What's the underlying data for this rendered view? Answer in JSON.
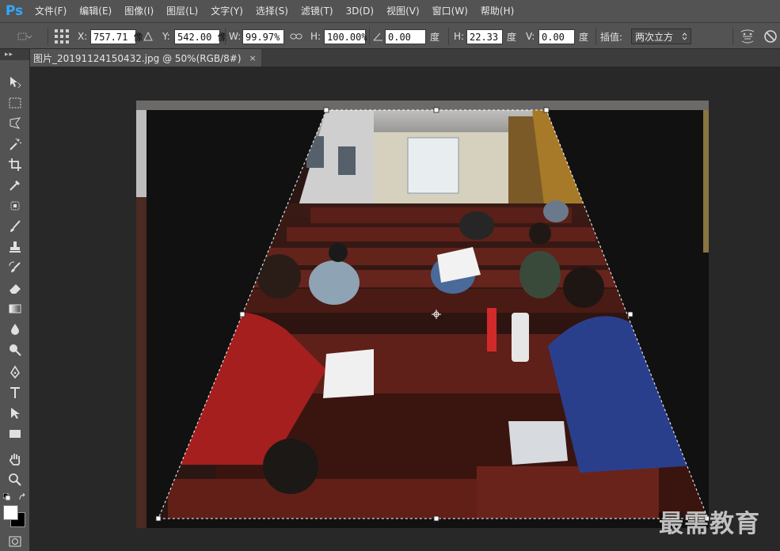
{
  "app": {
    "logo": "Ps"
  },
  "menu": [
    "文件(F)",
    "编辑(E)",
    "图像(I)",
    "图层(L)",
    "文字(Y)",
    "选择(S)",
    "滤镜(T)",
    "3D(D)",
    "视图(V)",
    "窗口(W)",
    "帮助(H)"
  ],
  "options": {
    "x_label": "X:",
    "x_value": "757.71 像",
    "y_label": "Y:",
    "y_value": "542.00 像",
    "w_label": "W:",
    "w_value": "99.97%",
    "h_label": "H:",
    "h_value": "100.00%",
    "angle_value": "0.00",
    "angle_unit": "度",
    "hskew_label": "H:",
    "hskew_value": "22.33",
    "hskew_unit": "度",
    "vskew_label": "V:",
    "vskew_value": "0.00",
    "vskew_unit": "度",
    "interp_label": "插值:",
    "interp_value": "两次立方"
  },
  "document": {
    "tab_title": "图片_20191124150432.jpg @ 50%(RGB/8#)",
    "close_glyph": "×"
  },
  "toolbar": {
    "header": "▸▸"
  },
  "watermark": "最需教育",
  "colors": {
    "accent": "#31a8ff",
    "foreground": "#ffffff",
    "background": "#000000"
  }
}
